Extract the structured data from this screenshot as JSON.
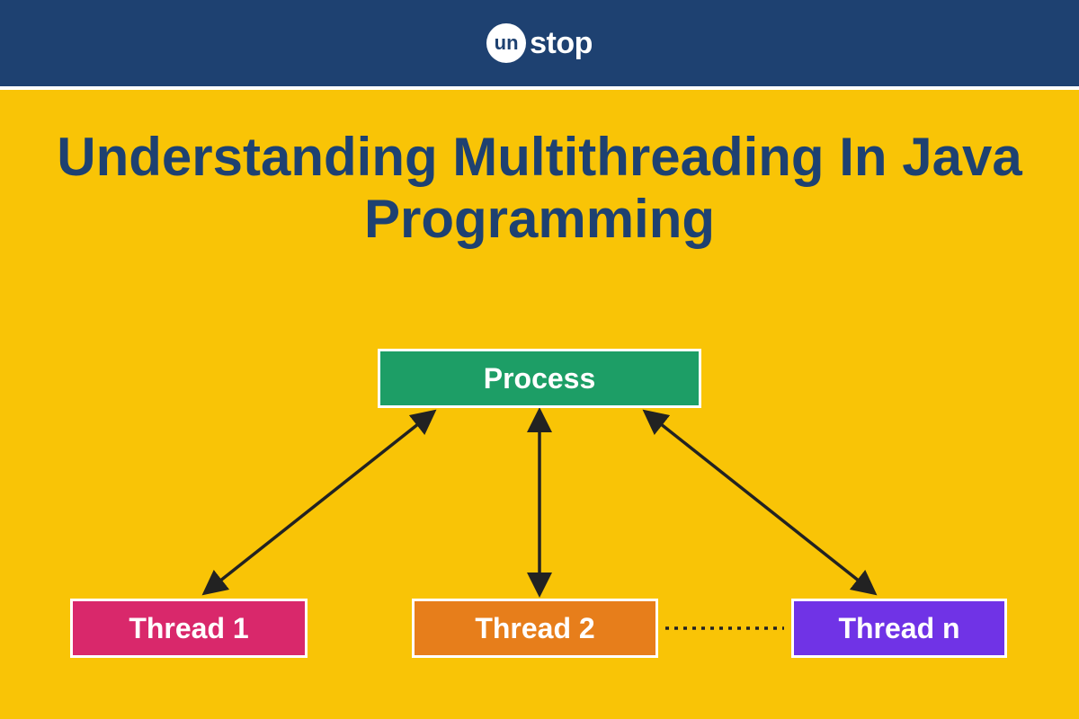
{
  "brand": {
    "iconText": "un",
    "name": "stop"
  },
  "title": "Understanding Multithreading In Java Programming",
  "diagram": {
    "process": "Process",
    "thread1": "Thread 1",
    "thread2": "Thread 2",
    "threadn": "Thread n"
  },
  "colors": {
    "headerBg": "#1e4171",
    "bodyBg": "#f9c406",
    "processBg": "#1d9e66",
    "thread1Bg": "#d9286b",
    "thread2Bg": "#e77e1b",
    "threadnBg": "#7033e6",
    "boxBorder": "#ffffff",
    "arrow": "#222222"
  }
}
